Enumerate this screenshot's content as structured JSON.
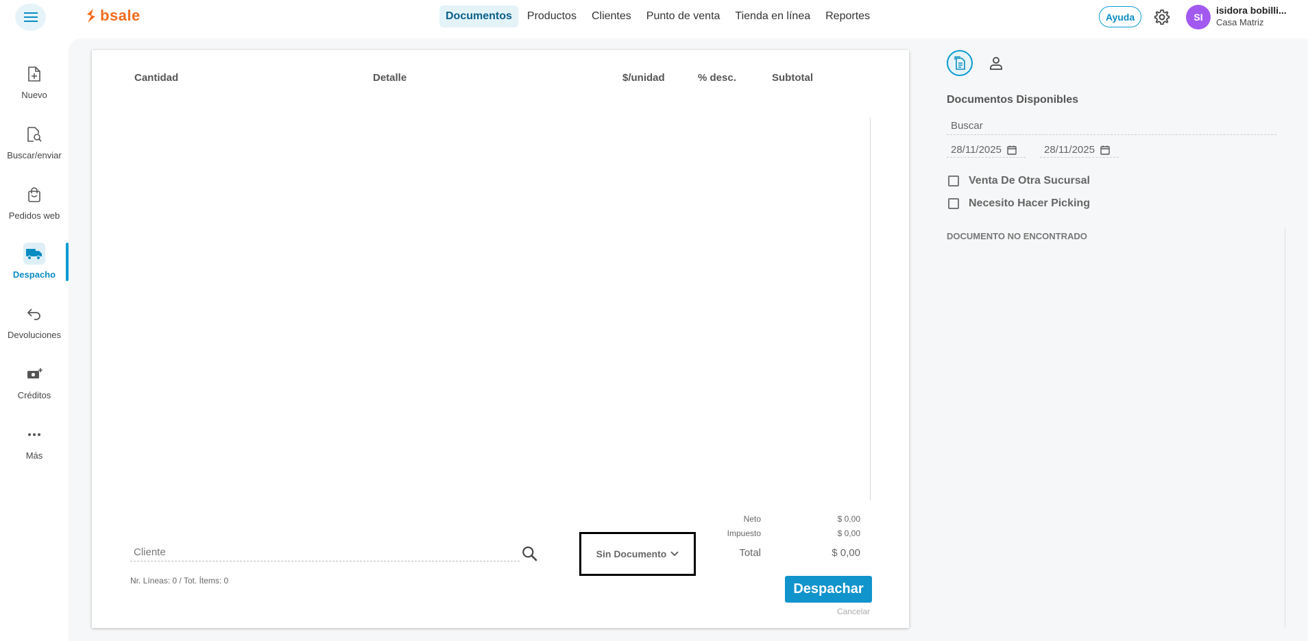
{
  "header": {
    "logo_text": "bsale",
    "nav": [
      {
        "label": "Documentos",
        "active": true
      },
      {
        "label": "Productos",
        "active": false
      },
      {
        "label": "Clientes",
        "active": false
      },
      {
        "label": "Punto de venta",
        "active": false
      },
      {
        "label": "Tienda en línea",
        "active": false
      },
      {
        "label": "Reportes",
        "active": false
      }
    ],
    "help_label": "Ayuda",
    "avatar_initials": "SI",
    "user_name": "isidora bobilli...",
    "user_branch": "Casa Matriz"
  },
  "sidebar": {
    "items": [
      {
        "label": "Nuevo",
        "icon": "file-plus-icon"
      },
      {
        "label": "Buscar/enviar",
        "icon": "file-search-icon"
      },
      {
        "label": "Pedidos web",
        "icon": "shopping-bag-icon"
      },
      {
        "label": "Despacho",
        "icon": "truck-icon",
        "active": true
      },
      {
        "label": "Devoluciones",
        "icon": "return-arrow-icon"
      },
      {
        "label": "Créditos",
        "icon": "money-plus-icon"
      },
      {
        "label": "Más",
        "icon": "more-dots-icon"
      }
    ]
  },
  "table": {
    "columns": [
      "Cantidad",
      "Detalle",
      "$/unidad",
      "% desc.",
      "Subtotal"
    ]
  },
  "footer": {
    "client_placeholder": "Cliente",
    "lines_count": "Nr. Líneas: 0 / Tot. Ítems: 0",
    "document_select": "Sin Documento",
    "neto_label": "Neto",
    "neto_value": "$ 0,00",
    "impuesto_label": "Impuesto",
    "impuesto_value": "$ 0,00",
    "total_label": "Total",
    "total_value": "$ 0,00",
    "dispatch_button": "Despachar",
    "cancel_link": "Cancelar"
  },
  "right_panel": {
    "title": "Documentos Disponibles",
    "search_placeholder": "Buscar",
    "date_from": "28/11/2025",
    "date_to": "28/11/2025",
    "checkbox_other_branch": "Venta De Otra Sucursal",
    "checkbox_picking": "Necesito Hacer Picking",
    "empty_message": "DOCUMENTO NO ENCONTRADO"
  },
  "colors": {
    "accent": "#1193cc",
    "brand": "#f26b1d",
    "avatar": "#a259f0"
  }
}
